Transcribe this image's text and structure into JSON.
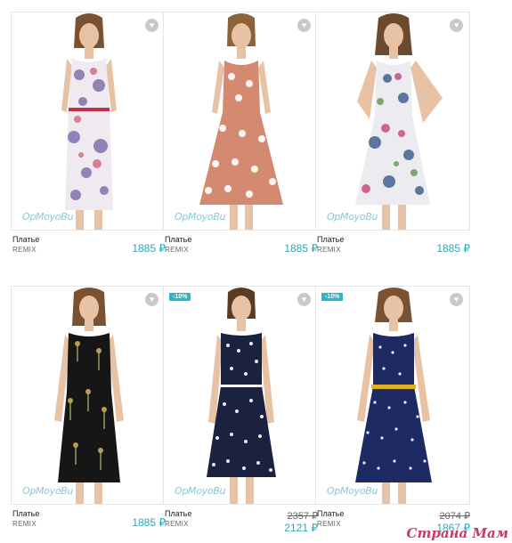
{
  "products": [
    {
      "name": "Платье",
      "brand": "REMIX",
      "price": "1885 ₽",
      "watermark": "OpMoyoBu",
      "dress_color": "#efe9f0",
      "pattern_color": "#7a6aa8",
      "belt_color": "#c0304a"
    },
    {
      "name": "Платье",
      "brand": "REMIX",
      "price": "1885 ₽",
      "watermark": "OpMoyoBu",
      "dress_color": "#d48a70",
      "pattern_color": "#ffffff",
      "belt_color": ""
    },
    {
      "name": "Платье",
      "brand": "REMIX",
      "price": "1885 ₽",
      "watermark": "OpMoyoBu",
      "dress_color": "#ecebf0",
      "pattern_color": "#3a5a8a",
      "belt_color": ""
    },
    {
      "name": "Платье",
      "brand": "REMIX",
      "price": "1885 ₽",
      "watermark": "OpMoyoBu",
      "dress_color": "#161616",
      "pattern_color": "#8aa060",
      "belt_color": ""
    },
    {
      "name": "Платье",
      "brand": "REMIX",
      "badge": "-10%",
      "old_price": "2357 ₽",
      "new_price": "2121 ₽",
      "watermark": "OpMoyoBu",
      "dress_color": "#1b2240",
      "pattern_color": "#ffffff",
      "belt_color": "#f2f2f2"
    },
    {
      "name": "Платье",
      "brand": "REMIX",
      "badge": "-10%",
      "old_price": "2074 ₽",
      "new_price": "1867 ₽",
      "watermark": "OpMoyoBu",
      "dress_color": "#1d2a63",
      "pattern_color": "#ffffff",
      "belt_color": "#e0b020"
    }
  ],
  "favorite_icon": "heart-icon",
  "site_watermark": "Страна Мам"
}
